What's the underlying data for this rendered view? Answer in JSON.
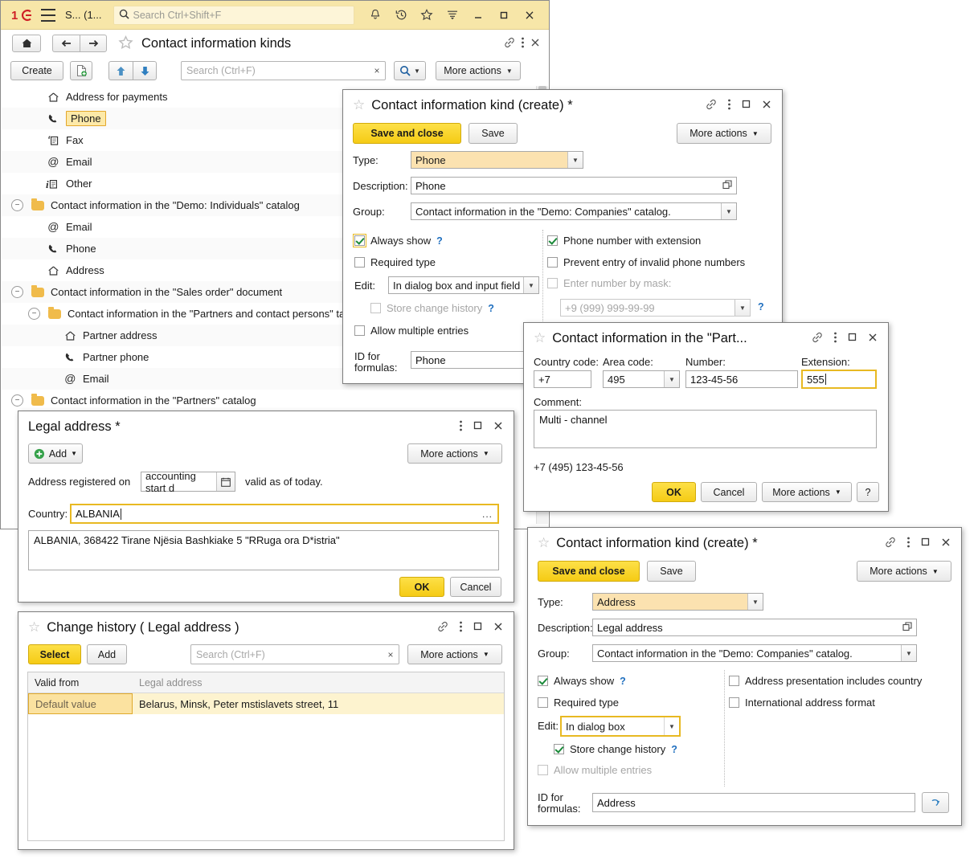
{
  "main_window": {
    "titlebar": {
      "logo": "1C",
      "menu_icon": "hamburger-icon",
      "app_label": "S...  (1...",
      "search_placeholder": "Search Ctrl+Shift+F",
      "icons": [
        "bell-icon",
        "history-icon",
        "star-icon",
        "filter-icon",
        "minimize-icon",
        "maximize-icon",
        "close-icon"
      ]
    },
    "navbar": {
      "home": "home-icon",
      "back": "back-icon",
      "forward": "forward-icon",
      "page_title": "Contact information kinds",
      "right_icons": [
        "link-icon",
        "more-icon",
        "close-icon"
      ]
    },
    "commandbar": {
      "create_label": "Create",
      "create_group_icon": "new-group-icon",
      "move_up_icon": "arrow-up-icon",
      "move_down_icon": "arrow-down-icon",
      "search_placeholder": "Search (Ctrl+F)",
      "search_clear": "×",
      "find_icon": "magnifier-icon",
      "more_actions": "More actions"
    },
    "tree": [
      {
        "label": "Address for payments",
        "icon": "home-icon",
        "indent": 2,
        "expander": "",
        "selected": false
      },
      {
        "label": "Phone",
        "icon": "phone-icon",
        "indent": 2,
        "expander": "",
        "selected": true
      },
      {
        "label": "Fax",
        "icon": "fax-icon",
        "indent": 2,
        "expander": "",
        "selected": false
      },
      {
        "label": "Email",
        "icon": "at-icon",
        "indent": 2,
        "expander": "",
        "selected": false
      },
      {
        "label": "Other",
        "icon": "info-icon",
        "indent": 2,
        "expander": "",
        "selected": false
      },
      {
        "label": "Contact information in the \"Demo: Individuals\" catalog",
        "icon": "folder-icon",
        "indent": 0,
        "expander": "−",
        "selected": false
      },
      {
        "label": "Email",
        "icon": "at-icon",
        "indent": 2,
        "expander": "",
        "selected": false
      },
      {
        "label": "Phone",
        "icon": "phone-icon",
        "indent": 2,
        "expander": "",
        "selected": false
      },
      {
        "label": "Address",
        "icon": "home-icon",
        "indent": 2,
        "expander": "",
        "selected": false
      },
      {
        "label": "Contact information in the \"Sales order\" document",
        "icon": "folder-icon",
        "indent": 0,
        "expander": "−",
        "selected": false
      },
      {
        "label": "Contact information in the \"Partners and contact persons\" ta",
        "icon": "folder-icon",
        "indent": 1,
        "expander": "−",
        "selected": false
      },
      {
        "label": "Partner address",
        "icon": "home-icon",
        "indent": 3,
        "expander": "",
        "selected": false
      },
      {
        "label": "Partner phone",
        "icon": "phone-icon",
        "indent": 3,
        "expander": "",
        "selected": false
      },
      {
        "label": "Email",
        "icon": "at-icon",
        "indent": 3,
        "expander": "",
        "selected": false
      },
      {
        "label": "Contact information in the \"Partners\" catalog",
        "icon": "folder-icon",
        "indent": 0,
        "expander": "−",
        "selected": false
      }
    ]
  },
  "dlg_kind_phone": {
    "title": "Contact information kind (create) *",
    "save_and_close": "Save and close",
    "save": "Save",
    "more_actions": "More actions",
    "type_label": "Type:",
    "type_value": "Phone",
    "description_label": "Description:",
    "description_value": "Phone",
    "group_label": "Group:",
    "group_value": "Contact information in the \"Demo: Companies\" catalog.",
    "always_show": "Always show",
    "required_type": "Required type",
    "edit_label": "Edit:",
    "edit_value": "In dialog box and input field",
    "store_change_history": "Store change history",
    "allow_multiple_entries": "Allow multiple entries",
    "id_for_formulas_label": "ID for formulas:",
    "id_for_formulas_value": "Phone",
    "phone_with_extension": "Phone number with extension",
    "prevent_invalid": "Prevent entry of invalid phone numbers",
    "enter_by_mask": "Enter number by mask:",
    "mask_placeholder": "+9 (999) 999-99-99",
    "help_mark": "?"
  },
  "dlg_phone_edit": {
    "title": "Contact information in the \"Part...",
    "country_code_label": "Country code:",
    "country_code_value": "+7",
    "area_code_label": "Area code:",
    "area_code_value": "495",
    "number_label": "Number:",
    "number_value": "123-45-56",
    "extension_label": "Extension:",
    "extension_value": "555",
    "comment_label": "Comment:",
    "comment_value": "Multi - channel",
    "preview": "+7 (495) 123-45-56",
    "ok": "OK",
    "cancel": "Cancel",
    "more_actions": "More actions",
    "help": "?"
  },
  "dlg_legal": {
    "title": "Legal address *",
    "add": "Add",
    "more_actions": "More actions",
    "registered_prefix": "Address registered on",
    "registered_date": "accounting start d",
    "registered_suffix": "valid as of today.",
    "country_label": "Country:",
    "country_value": "ALBANIA",
    "address_text": "ALBANIA, 368422 Tirane Njësia  Bashkiake 5 \"RRuga ora D*istria\"",
    "ok": "OK",
    "cancel": "Cancel"
  },
  "dlg_history": {
    "title": "Change history ( Legal address )",
    "select": "Select",
    "add": "Add",
    "search_placeholder": "Search (Ctrl+F)",
    "search_clear": "×",
    "more_actions": "More actions",
    "columns": [
      "Valid from",
      "Legal address"
    ],
    "rows": [
      {
        "valid_from": "Default value",
        "legal_address": "Belarus, Minsk, Peter mstislavets street, 11"
      }
    ]
  },
  "dlg_kind_addr": {
    "title": "Contact information kind (create) *",
    "save_and_close": "Save and close",
    "save": "Save",
    "more_actions": "More actions",
    "type_label": "Type:",
    "type_value": "Address",
    "description_label": "Description:",
    "description_value": "Legal address",
    "group_label": "Group:",
    "group_value": "Contact information in the \"Demo: Companies\" catalog.",
    "always_show": "Always show",
    "required_type": "Required type",
    "edit_label": "Edit:",
    "edit_value": "In dialog box",
    "store_change_history": "Store change history",
    "allow_multiple_entries": "Allow multiple entries",
    "id_for_formulas_label": "ID for formulas:",
    "id_for_formulas_value": "Address",
    "presentation_includes_country": "Address presentation includes country",
    "international_format": "International address format",
    "help_mark": "?"
  },
  "colors": {
    "accent_yellow": "#f5cb15",
    "title_bar": "#f7e6a8",
    "selection": "#fde9a8",
    "focus_border": "#e8b922",
    "logo_red": "#cf1f26",
    "check_green": "#1b8a3a",
    "help_blue": "#1f6fbf"
  }
}
